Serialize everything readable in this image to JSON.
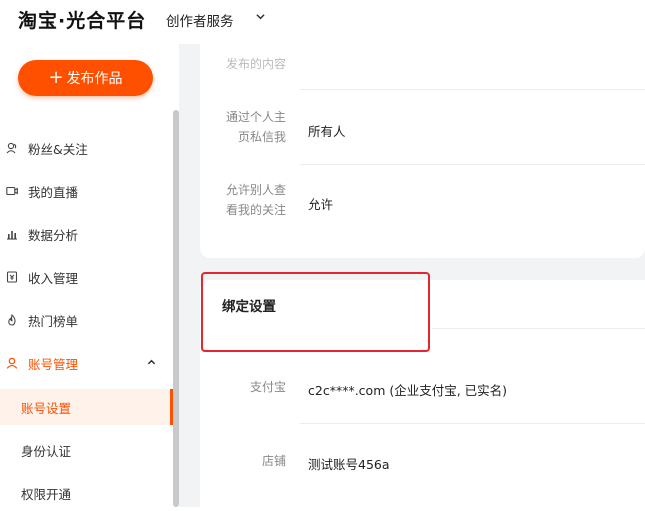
{
  "header": {
    "logo": "淘宝·光合平台",
    "service": "创作者服务"
  },
  "sidebar": {
    "publish_label": "发布作品",
    "items": [
      {
        "label": "粉丝&关注",
        "icon": "fans-icon"
      },
      {
        "label": "我的直播",
        "icon": "live-icon"
      },
      {
        "label": "数据分析",
        "icon": "chart-icon"
      },
      {
        "label": "收入管理",
        "icon": "income-icon"
      },
      {
        "label": "热门榜单",
        "icon": "flame-icon"
      },
      {
        "label": "账号管理",
        "icon": "user-icon"
      }
    ],
    "sub_items": [
      {
        "label": "账号设置"
      },
      {
        "label": "身份认证"
      },
      {
        "label": "权限开通"
      }
    ]
  },
  "privacy": {
    "partial_label": "发布的内容",
    "rows": [
      {
        "label_line1": "通过个人主",
        "label_line2": "页私信我",
        "value": "所有人"
      },
      {
        "label_line1": "允许别人查",
        "label_line2": "看我的关注",
        "value": "允许"
      }
    ]
  },
  "binding": {
    "title": "绑定设置",
    "rows": [
      {
        "label": "支付宝",
        "value": "c2c****.com (企业支付宝, 已实名)"
      },
      {
        "label": "店铺",
        "value": "测试账号456a"
      }
    ]
  },
  "colors": {
    "accent": "#ff5000",
    "highlight": "#e3262f"
  }
}
